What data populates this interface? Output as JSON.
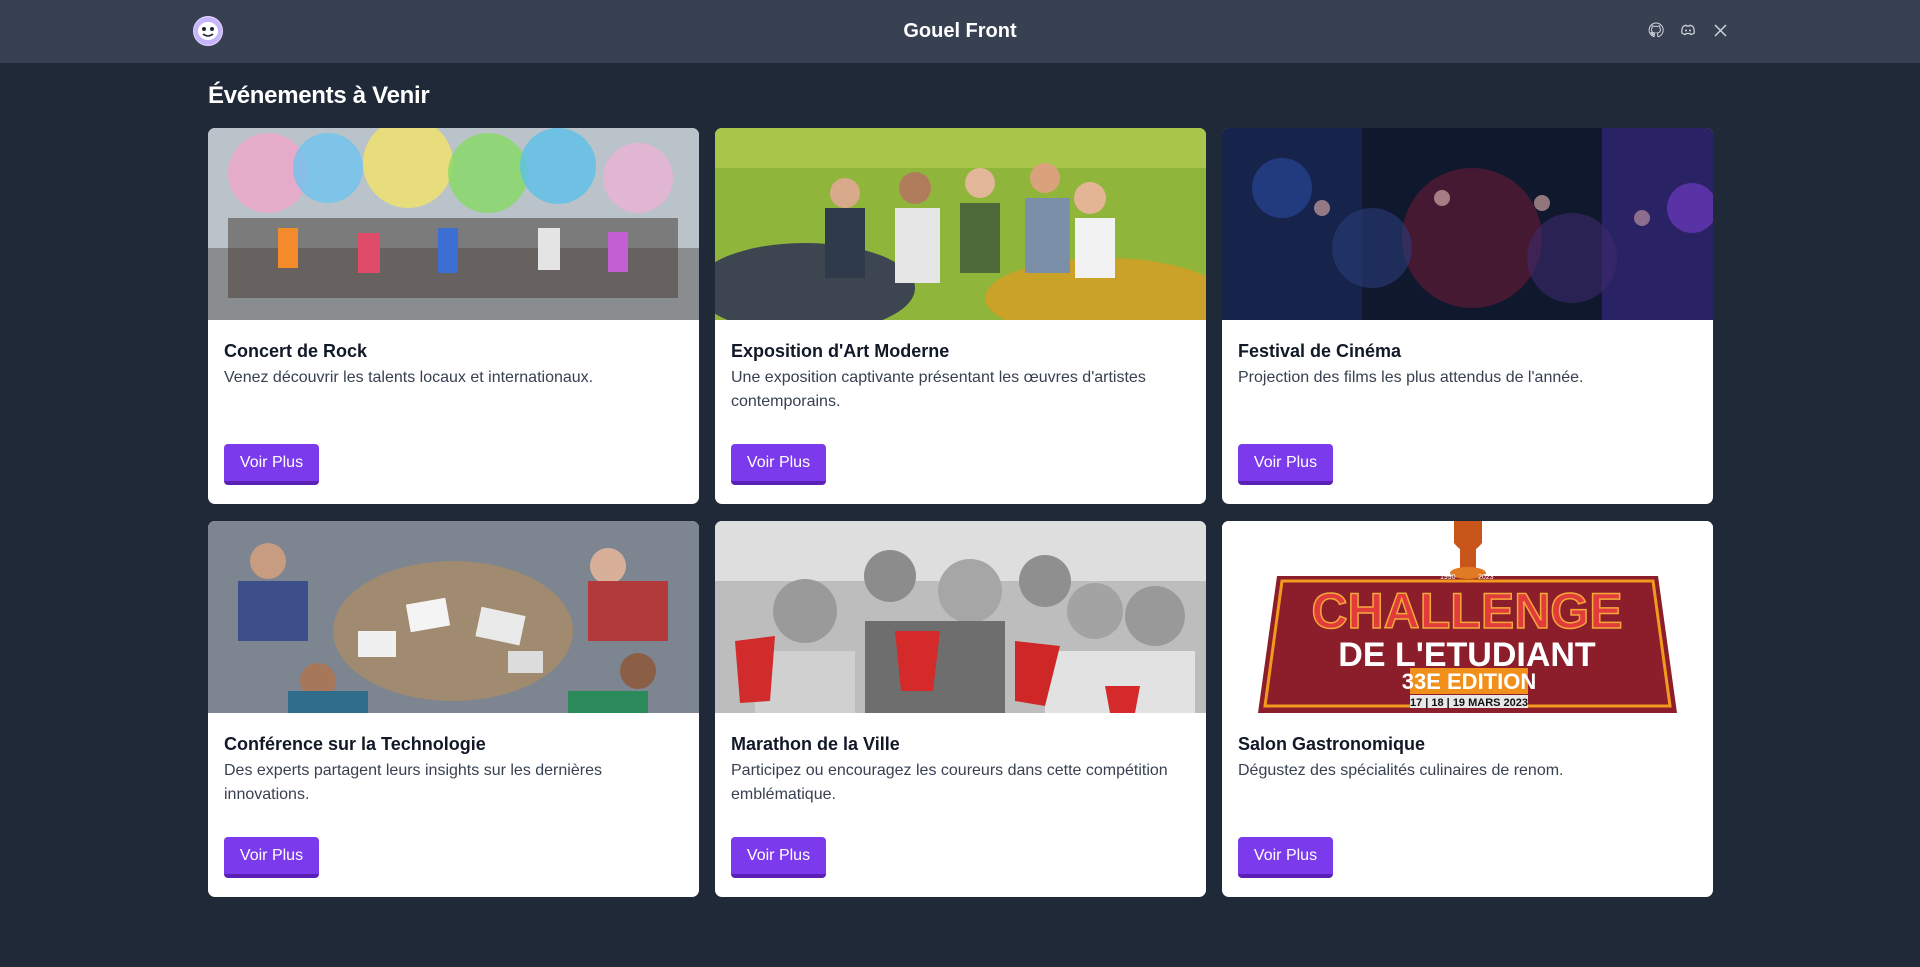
{
  "app": {
    "title": "Gouel Front"
  },
  "header": {
    "social": [
      {
        "icon": "github-icon"
      },
      {
        "icon": "discord-icon"
      },
      {
        "icon": "x-icon"
      }
    ]
  },
  "main": {
    "heading": "Événements à Venir",
    "events": [
      {
        "title": "Concert de Rock",
        "description": "Venez découvrir les talents locaux et internationaux.",
        "button": "Voir Plus",
        "image": "color-powder-crowd"
      },
      {
        "title": "Exposition d'Art Moderne",
        "description": "Une exposition captivante présentant les œuvres d'artistes contemporains.",
        "button": "Voir Plus",
        "image": "friends-on-grass"
      },
      {
        "title": "Festival de Cinéma",
        "description": "Projection des films les plus attendus de l'année.",
        "button": "Voir Plus",
        "image": "dark-party-crowd"
      },
      {
        "title": "Conférence sur la Technologie",
        "description": "Des experts partagent leurs insights sur les dernières innovations.",
        "button": "Voir Plus",
        "image": "students-around-table"
      },
      {
        "title": "Marathon de la Ville",
        "description": "Participez ou encouragez les coureurs dans cette compétition emblématique.",
        "button": "Voir Plus",
        "image": "friends-red-cups"
      },
      {
        "title": "Salon Gastronomique",
        "description": "Dégustez des spécialités culinaires de renom.",
        "button": "Voir Plus",
        "image": "challenge-poster",
        "poster": {
          "years": [
            "1990",
            "2023"
          ],
          "line1": "CHALLENGE",
          "line2": "DE L'ETUDIANT",
          "edition": "33E EDITION",
          "dates": "17 | 18 | 19 MARS 2023"
        }
      }
    ]
  },
  "colors": {
    "header_bg": "#374151",
    "page_bg": "#1f2937",
    "button": "#7c3aed",
    "button_shadow": "#5b21b6"
  }
}
